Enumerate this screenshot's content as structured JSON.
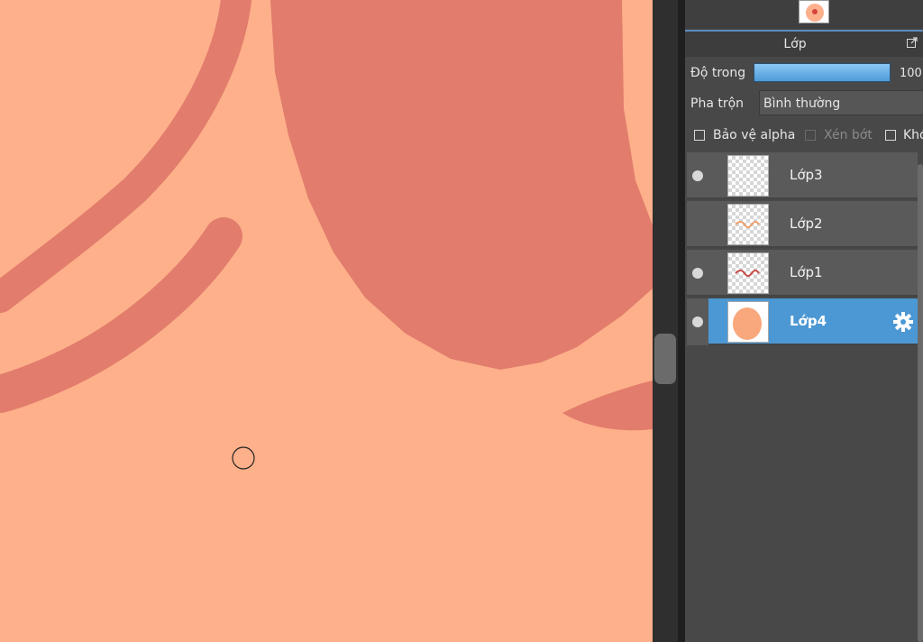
{
  "colors": {
    "canvas_bg": "#fdb08a",
    "canvas_stroke": "#e27c6c",
    "panel_bg": "#484848",
    "selected_row": "#4c98d4",
    "opacity_bar": "#6fb6ee"
  },
  "panel": {
    "title": "Lớp",
    "popout_icon": "popout-icon"
  },
  "properties": {
    "opacity_label": "Độ trong",
    "opacity_value": "100",
    "opacity_fraction": 1.0,
    "blend_label": "Pha trộn",
    "blend_value": "Bình thường"
  },
  "options": {
    "protect_alpha": "Bảo vệ alpha",
    "clipping": "Xén bớt",
    "lock": "Khó"
  },
  "layers": [
    {
      "name": "Lớp3",
      "visible": true,
      "selected": false,
      "thumb_text": ""
    },
    {
      "name": "Lớp2",
      "visible": false,
      "selected": false,
      "thumb_text": "Châu"
    },
    {
      "name": "Lớp1",
      "visible": true,
      "selected": false,
      "thumb_text": "Châu"
    },
    {
      "name": "Lớp4",
      "visible": true,
      "selected": true,
      "thumb_text": ""
    }
  ],
  "icons": {
    "visibility": "eye-icon",
    "settings": "gear-icon",
    "cursor": "brush-cursor-icon"
  }
}
